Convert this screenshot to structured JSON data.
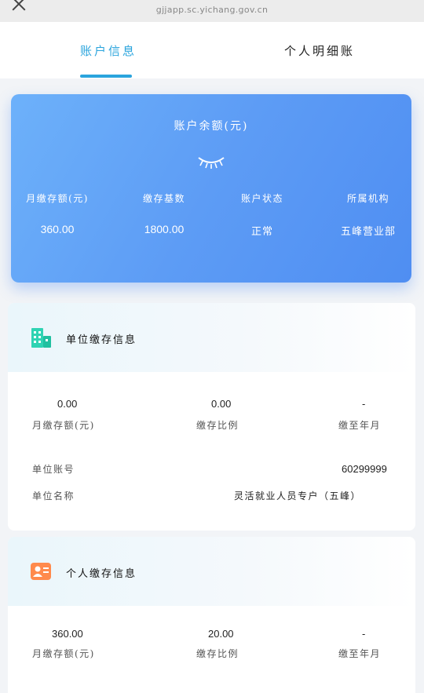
{
  "browser": {
    "url": "gjjapp.sc.yichang.gov.cn"
  },
  "tabs": [
    {
      "label": "账户信息",
      "active": true
    },
    {
      "label": "个人明细账",
      "active": false
    }
  ],
  "balance_card": {
    "title": "账户余额(元)",
    "stats": [
      {
        "label": "月缴存额(元)",
        "value": "360.00"
      },
      {
        "label": "缴存基数",
        "value": "1800.00"
      },
      {
        "label": "账户状态",
        "value": "正常"
      },
      {
        "label": "所属机构",
        "value": "五峰营业部"
      }
    ]
  },
  "unit_section": {
    "title": "单位缴存信息",
    "metrics": [
      {
        "value": "0.00",
        "label": "月缴存额(元)"
      },
      {
        "value": "0.00",
        "label": "缴存比例"
      },
      {
        "value": "-",
        "label": "缴至年月"
      }
    ],
    "rows": [
      {
        "label": "单位账号",
        "value": "60299999"
      },
      {
        "label": "单位名称",
        "value": "灵活就业人员专户（五峰）"
      }
    ]
  },
  "personal_section": {
    "title": "个人缴存信息",
    "metrics": [
      {
        "value": "360.00",
        "label": "月缴存额(元)"
      },
      {
        "value": "20.00",
        "label": "缴存比例"
      },
      {
        "value": "-",
        "label": "缴至年月"
      }
    ]
  }
}
